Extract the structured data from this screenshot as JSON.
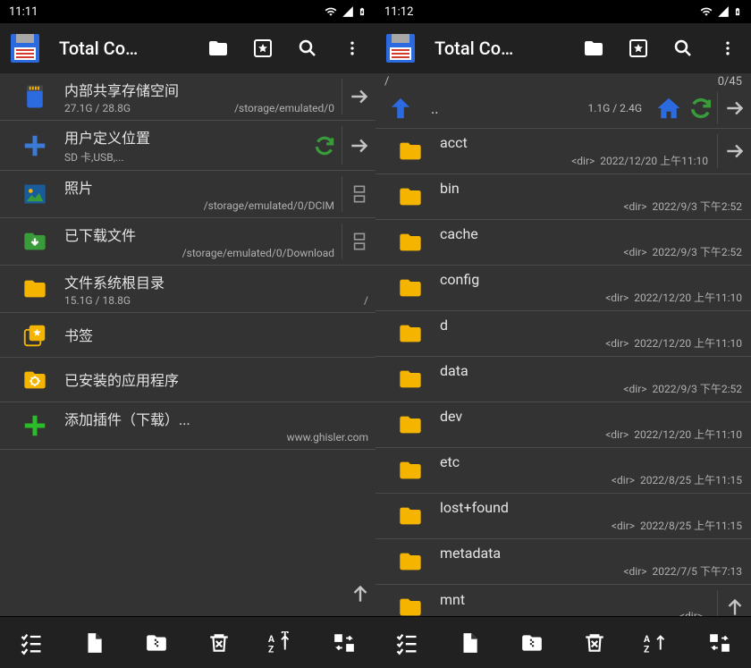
{
  "left": {
    "statusbar": {
      "time": "11:11"
    },
    "appbar": {
      "title": "Total Co…"
    },
    "entries": [
      {
        "kind": "internal",
        "title": "内部共享存储空间",
        "subleft": "27.1G / 28.8G",
        "subright": "/storage/emulated/0",
        "arrow": true
      },
      {
        "kind": "plus",
        "title": "用户定义位置",
        "subleft": "SD 卡,USB,...",
        "subright": "",
        "arrow": true,
        "refresh": true
      },
      {
        "kind": "photo",
        "title": "照片",
        "subleft": "",
        "subright": "/storage/emulated/0/DCIM",
        "side": true
      },
      {
        "kind": "download",
        "title": "已下载文件",
        "subleft": "",
        "subright": "/storage/emulated/0/Download",
        "side": true
      },
      {
        "kind": "folder",
        "title": "文件系统根目录",
        "subleft": "15.1G / 18.8G",
        "subright": "/"
      },
      {
        "kind": "bookmark",
        "title": "书签",
        "subleft": "",
        "subright": ""
      },
      {
        "kind": "apps",
        "title": "已安装的应用程序",
        "subleft": "",
        "subright": ""
      },
      {
        "kind": "addplugin",
        "title": "添加插件（下载）...",
        "subleft": "",
        "subright": "www.ghisler.com"
      }
    ]
  },
  "right": {
    "statusbar": {
      "time": "11:12"
    },
    "appbar": {
      "title": "Total Co…"
    },
    "path": "/",
    "count": "0/45",
    "parent": {
      "dots": "..",
      "size": "1.1G / 2.4G"
    },
    "dirs": [
      {
        "name": "acct",
        "type": "<dir>",
        "when": "2022/12/20 上午11:10",
        "arrow": true
      },
      {
        "name": "bin",
        "type": "<dir>",
        "when": "2022/9/3 下午2:52"
      },
      {
        "name": "cache",
        "type": "<dir>",
        "when": "2022/9/3 下午2:52"
      },
      {
        "name": "config",
        "type": "<dir>",
        "when": "2022/12/20 上午11:10"
      },
      {
        "name": "d",
        "type": "<dir>",
        "when": "2022/12/20 上午11:10"
      },
      {
        "name": "data",
        "type": "<dir>",
        "when": "2022/9/3 下午2:52"
      },
      {
        "name": "dev",
        "type": "<dir>",
        "when": "2022/12/20 上午11:10"
      },
      {
        "name": "etc",
        "type": "<dir>",
        "when": "2022/8/25 上午11:15"
      },
      {
        "name": "lost+found",
        "type": "<dir>",
        "when": "2022/8/25 上午11:15"
      },
      {
        "name": "metadata",
        "type": "<dir>",
        "when": "2022/7/5 下午7:13"
      },
      {
        "name": "mnt",
        "type": "<dir>",
        "when": "",
        "arrowUp": true
      }
    ]
  }
}
